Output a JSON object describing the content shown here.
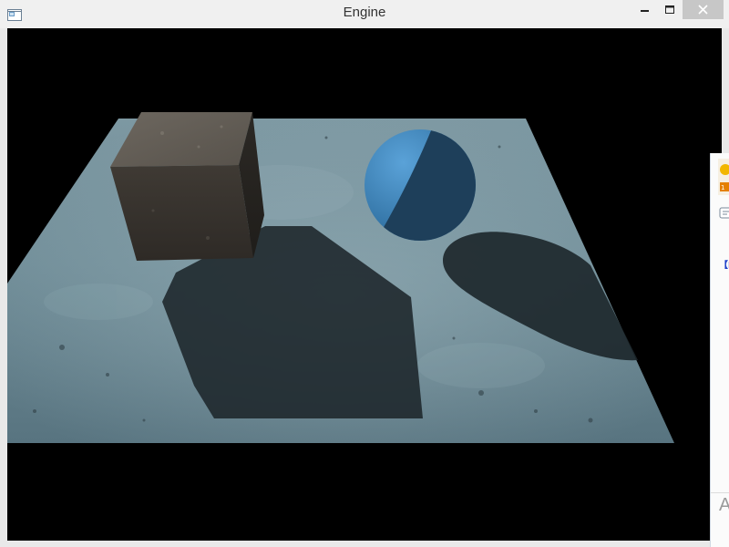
{
  "window": {
    "title": "Engine",
    "controls": [
      "minimize",
      "maximize",
      "close"
    ]
  },
  "scene": {
    "background_color": "#000000",
    "objects": [
      "textured-floor-plane",
      "stone-cube",
      "blue-sphere",
      "cube-shadow",
      "sphere-shadow"
    ],
    "colors": {
      "floor": "#6f8f9b",
      "cube": "#4a4540",
      "sphere_lit": "#3a7fb8",
      "sphere_dark": "#1e3f5a",
      "shadow": "#1c262a"
    }
  },
  "background_window": {
    "partial_text": "【E",
    "partial_input_glyph": "A",
    "icons": [
      "qq-penguin-icon",
      "chat-bubble-icon"
    ]
  }
}
